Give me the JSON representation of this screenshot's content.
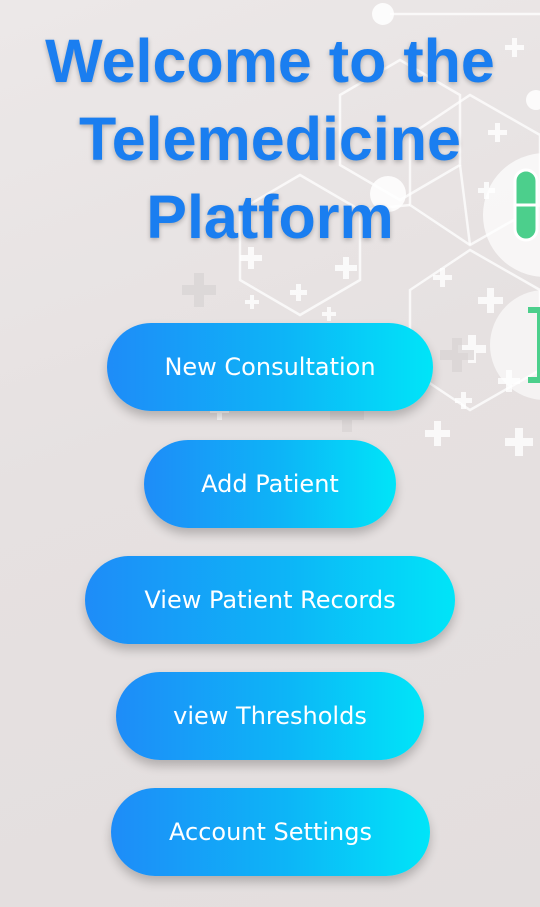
{
  "header": {
    "title_lines": [
      "Welcome to the",
      "Telemedicine",
      "Platform"
    ]
  },
  "menu": {
    "buttons": [
      {
        "label": "New Consultation"
      },
      {
        "label": "Add Patient"
      },
      {
        "label": "View Patient Records"
      },
      {
        "label": "view Thresholds"
      },
      {
        "label": "Account Settings"
      }
    ]
  },
  "colors": {
    "title": "#1a7ef0",
    "button_start": "#1e8cf8",
    "button_end": "#00e5f8",
    "background": "#e8e4e4",
    "pill_accent": "#4ccf8c"
  },
  "icons": [
    "medical-network-background",
    "capsule-icon",
    "plus-cross-icon"
  ]
}
